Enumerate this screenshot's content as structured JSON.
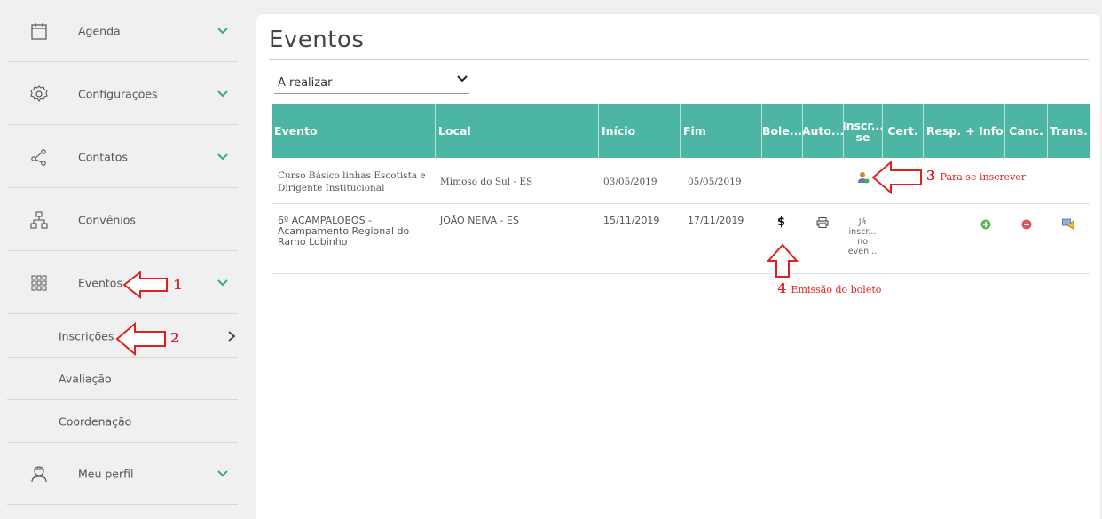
{
  "sidebar": {
    "items": [
      {
        "label": "Agenda",
        "icon": "calendar-icon"
      },
      {
        "label": "Configurações",
        "icon": "settings-icon"
      },
      {
        "label": "Contatos",
        "icon": "share-icon"
      },
      {
        "label": "Convênios",
        "icon": "hierarchy-icon"
      },
      {
        "label": "Eventos",
        "icon": "grid-icon"
      },
      {
        "label": "Meu perfil",
        "icon": "user-icon"
      }
    ],
    "sub_items": [
      {
        "label": "Inscrições"
      },
      {
        "label": "Avaliação"
      },
      {
        "label": "Coordenação"
      }
    ]
  },
  "main": {
    "title": "Eventos",
    "filter": {
      "selected": "A realizar"
    },
    "columns": [
      "Evento",
      "Local",
      "Início",
      "Fim",
      "Bole...",
      "Auto...",
      "Inscr...",
      "se",
      "Cert.",
      "Resp.",
      "+ Info",
      "Canc.",
      "Trans."
    ],
    "rows": [
      {
        "evento": "Curso Básico linhas Escotista e Dirigente Institucional",
        "local": "Mimoso do Sul - ES",
        "inicio": "03/05/2019",
        "fim": "05/05/2019"
      },
      {
        "evento": "6º ACAMPALOBOS - Acampamento Regional do Ramo Lobinho",
        "local": "JOÃO NEIVA - ES",
        "inicio": "15/11/2019",
        "fim": "17/11/2019",
        "boleto": "$",
        "status": "Já inscr... no even..."
      }
    ]
  },
  "annotations": {
    "a1": "1",
    "a2": "2",
    "a3_num": "3",
    "a3_text": "Para se inscrever",
    "a4_num": "4",
    "a4_text": "Emissão do boleto"
  },
  "colors": {
    "header": "#4cb5a3",
    "accent_chevron": "#3aa58f",
    "annotation": "#e02020"
  }
}
